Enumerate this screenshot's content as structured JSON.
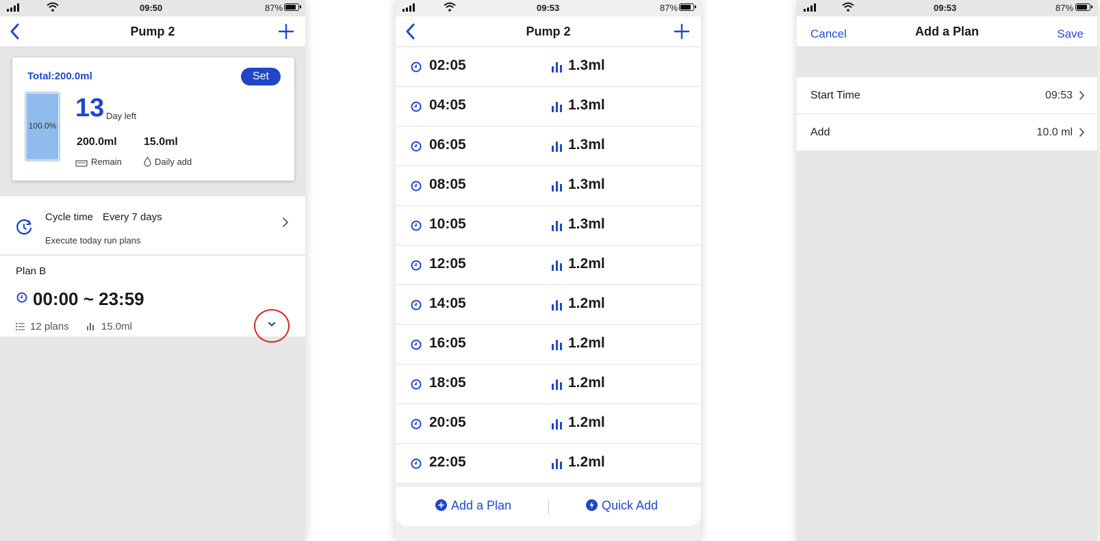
{
  "colors": {
    "accent": "#1f47c8",
    "annotation": "#d2232a",
    "background": "#e6e6e6"
  },
  "screen1": {
    "status": {
      "time": "09:50",
      "battery": "87%"
    },
    "nav": {
      "title": "Pump 2",
      "back_icon": "back-chevron-icon",
      "add_icon": "plus-icon"
    },
    "card": {
      "total": "Total:200.0ml",
      "set_label": "Set",
      "tank_percent": "100.0%",
      "tank_fill": 1.0,
      "days_value": "13",
      "days_label": "Day left",
      "remain_value": "200.0ml",
      "remain_label": "Remain",
      "daily_value": "15.0ml",
      "daily_label": "Daily add"
    },
    "cycle": {
      "label": "Cycle time",
      "value": "Every 7 days",
      "subtitle": "Execute today run plans"
    },
    "plan": {
      "name": "Plan B",
      "range": "00:00 ~ 23:59",
      "plans_count": "12 plans",
      "volume": "15.0ml"
    }
  },
  "screen2": {
    "status": {
      "time": "09:53",
      "battery": "87%"
    },
    "nav": {
      "title": "Pump 2"
    },
    "schedule": [
      {
        "time": "02:05",
        "amount": "1.3ml"
      },
      {
        "time": "04:05",
        "amount": "1.3ml"
      },
      {
        "time": "06:05",
        "amount": "1.3ml"
      },
      {
        "time": "08:05",
        "amount": "1.3ml"
      },
      {
        "time": "10:05",
        "amount": "1.3ml"
      },
      {
        "time": "12:05",
        "amount": "1.2ml"
      },
      {
        "time": "14:05",
        "amount": "1.2ml"
      },
      {
        "time": "16:05",
        "amount": "1.2ml"
      },
      {
        "time": "18:05",
        "amount": "1.2ml"
      },
      {
        "time": "20:05",
        "amount": "1.2ml"
      },
      {
        "time": "22:05",
        "amount": "1.2ml"
      }
    ],
    "bottom": {
      "add_plan": "Add a Plan",
      "quick_add": "Quick Add"
    }
  },
  "screen3": {
    "status": {
      "time": "09:53",
      "battery": "87%"
    },
    "nav": {
      "cancel": "Cancel",
      "title": "Add a Plan",
      "save": "Save"
    },
    "fields": [
      {
        "label": "Start Time",
        "value": "09:53"
      },
      {
        "label": "Add",
        "value": "10.0 ml"
      }
    ]
  }
}
